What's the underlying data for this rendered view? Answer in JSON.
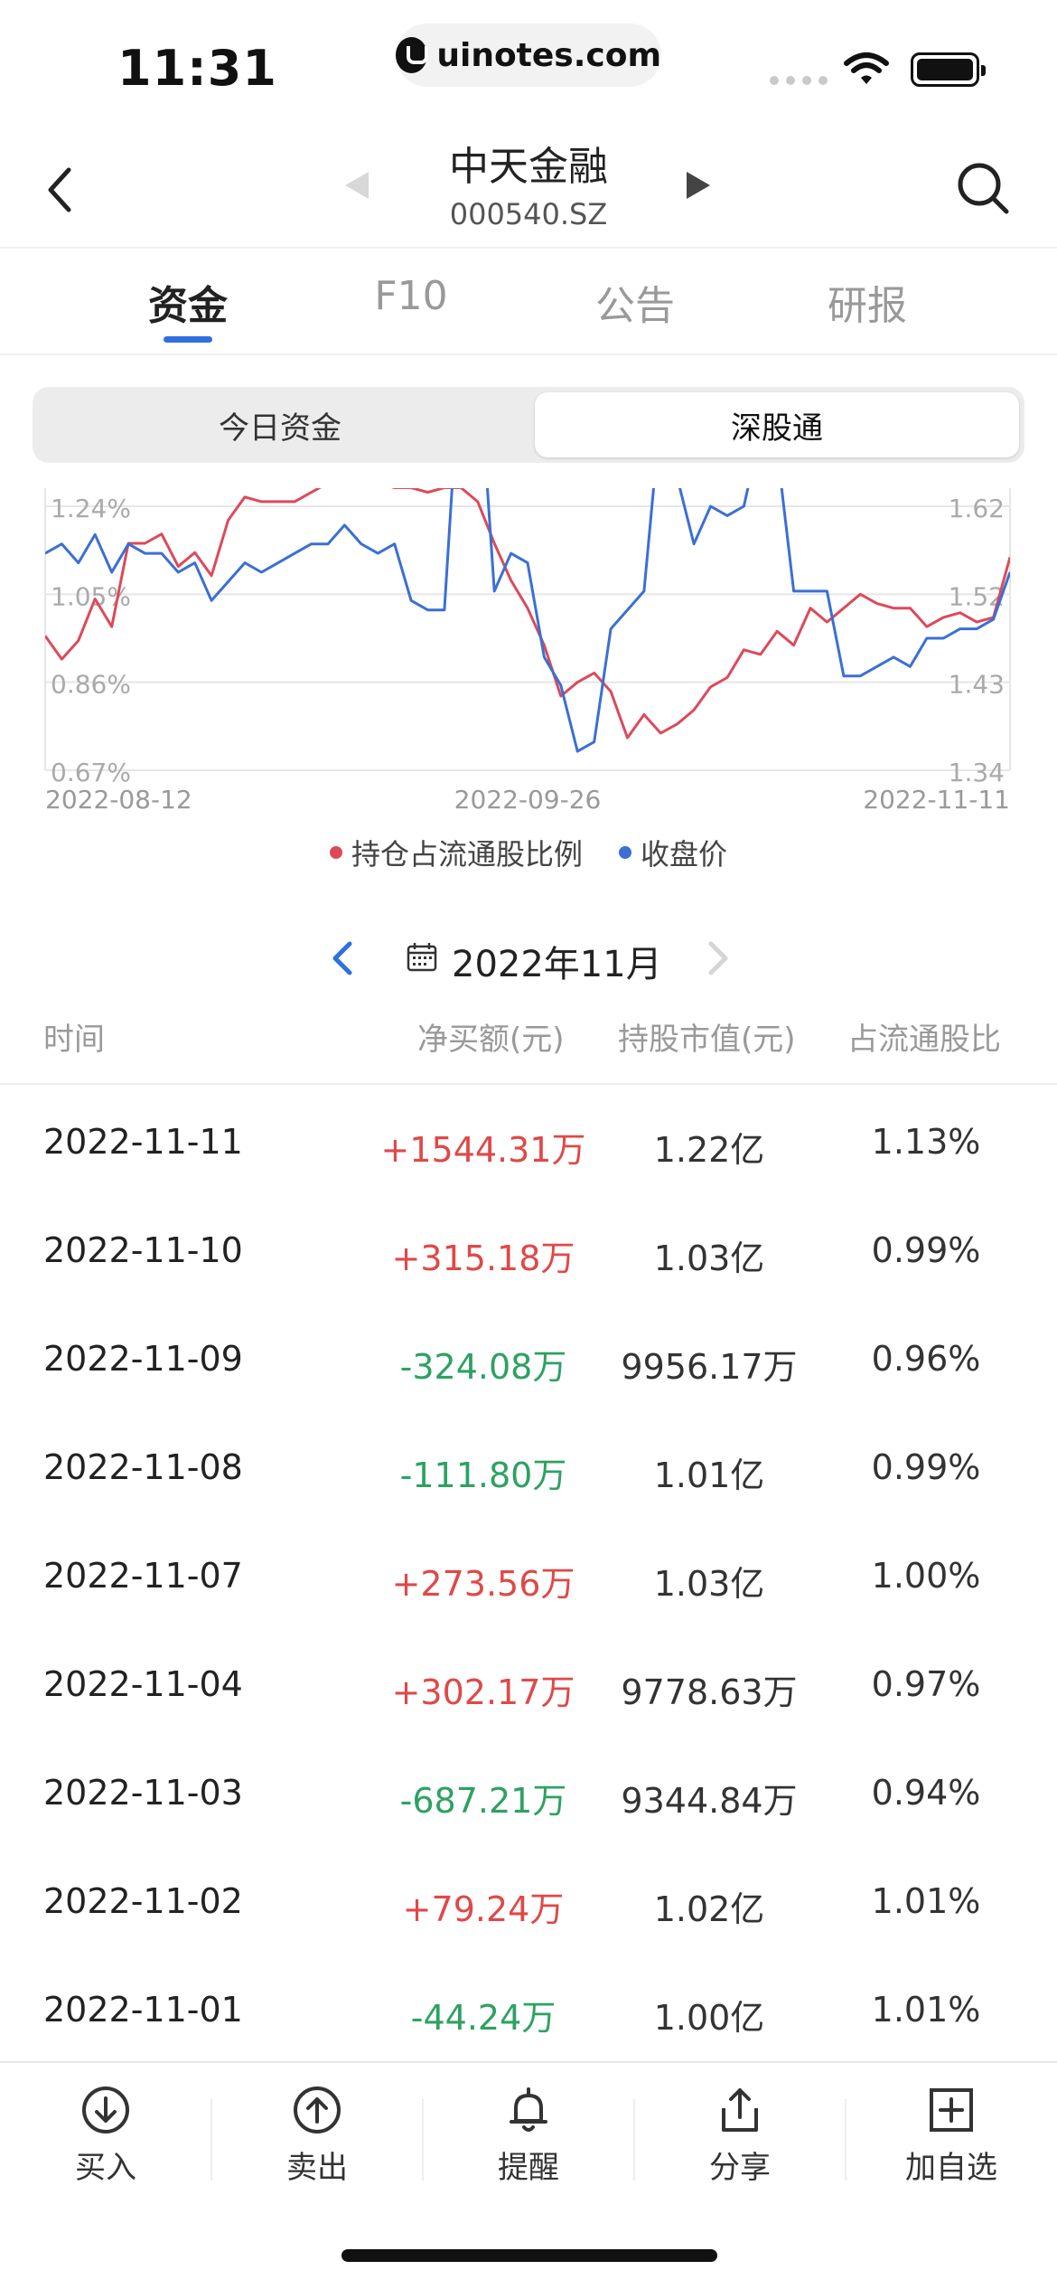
{
  "status": {
    "time": "11:31",
    "url": "uinotes.com"
  },
  "header": {
    "stock_name": "中天金融",
    "stock_code": "000540.SZ"
  },
  "tabs": [
    {
      "label": "资金",
      "active": true
    },
    {
      "label": "F10",
      "active": false
    },
    {
      "label": "公告",
      "active": false
    },
    {
      "label": "研报",
      "active": false
    }
  ],
  "segment": {
    "items": [
      "今日资金",
      "深股通"
    ],
    "selected": "深股通"
  },
  "chart_data": {
    "type": "line",
    "x_start": "2022-08-12",
    "x_mid": "2022-09-26",
    "x_end": "2022-11-11",
    "x_tick_labels": [
      "2022-08-12",
      "2022-09-26",
      "2022-11-11"
    ],
    "left_axis_ticks": [
      "1.24%",
      "1.05%",
      "0.86%",
      "0.67%"
    ],
    "right_axis_ticks": [
      "1.62",
      "1.52",
      "1.43",
      "1.34"
    ],
    "ylim_left": [
      0.67,
      1.24
    ],
    "ylim_right": [
      1.34,
      1.62
    ],
    "series": [
      {
        "name": "持仓占流通股比例",
        "axis": "left",
        "color": "#dc4a5a",
        "values": [
          0.96,
          0.91,
          0.95,
          1.04,
          0.98,
          1.16,
          1.16,
          1.18,
          1.11,
          1.14,
          1.09,
          1.21,
          1.26,
          1.25,
          1.25,
          1.25,
          1.27,
          1.29,
          1.3,
          1.31,
          1.29,
          1.28,
          1.28,
          1.27,
          1.28,
          1.28,
          1.25,
          1.16,
          1.08,
          1.02,
          0.94,
          0.83,
          0.86,
          0.88,
          0.84,
          0.74,
          0.79,
          0.75,
          0.77,
          0.8,
          0.85,
          0.87,
          0.93,
          0.92,
          0.97,
          0.94,
          1.02,
          0.99,
          1.02,
          1.05,
          1.03,
          1.02,
          1.02,
          0.98,
          1.0,
          1.01,
          0.99,
          1.0,
          1.13
        ]
      },
      {
        "name": "收盘价",
        "axis": "right",
        "color": "#3b6fd4",
        "values": [
          1.57,
          1.58,
          1.56,
          1.59,
          1.55,
          1.58,
          1.57,
          1.57,
          1.55,
          1.56,
          1.52,
          1.54,
          1.56,
          1.55,
          1.56,
          1.57,
          1.58,
          1.58,
          1.6,
          1.58,
          1.57,
          1.58,
          1.52,
          1.51,
          1.51,
          1.79,
          1.79,
          1.53,
          1.57,
          1.56,
          1.46,
          1.43,
          1.36,
          1.37,
          1.49,
          1.51,
          1.53,
          1.72,
          1.65,
          1.58,
          1.62,
          1.61,
          1.62,
          1.7,
          1.68,
          1.53,
          1.53,
          1.53,
          1.44,
          1.44,
          1.45,
          1.46,
          1.45,
          1.48,
          1.48,
          1.49,
          1.49,
          1.5,
          1.55
        ]
      }
    ],
    "legend": [
      "持仓占流通股比例",
      "收盘价"
    ],
    "legend_position": "bottom-center",
    "grid": true
  },
  "month": {
    "label": "2022年11月"
  },
  "table": {
    "headers": [
      "时间",
      "净买额(元)",
      "持股市值(元)",
      "占流通股比"
    ],
    "rows": [
      {
        "date": "2022-11-11",
        "net": "+1544.31万",
        "dir": "pos",
        "value": "1.22亿",
        "pct": "1.13%"
      },
      {
        "date": "2022-11-10",
        "net": "+315.18万",
        "dir": "pos",
        "value": "1.03亿",
        "pct": "0.99%"
      },
      {
        "date": "2022-11-09",
        "net": "-324.08万",
        "dir": "neg",
        "value": "9956.17万",
        "pct": "0.96%"
      },
      {
        "date": "2022-11-08",
        "net": "-111.80万",
        "dir": "neg",
        "value": "1.01亿",
        "pct": "0.99%"
      },
      {
        "date": "2022-11-07",
        "net": "+273.56万",
        "dir": "pos",
        "value": "1.03亿",
        "pct": "1.00%"
      },
      {
        "date": "2022-11-04",
        "net": "+302.17万",
        "dir": "pos",
        "value": "9778.63万",
        "pct": "0.97%"
      },
      {
        "date": "2022-11-03",
        "net": "-687.21万",
        "dir": "neg",
        "value": "9344.84万",
        "pct": "0.94%"
      },
      {
        "date": "2022-11-02",
        "net": "+79.24万",
        "dir": "pos",
        "value": "1.02亿",
        "pct": "1.01%"
      },
      {
        "date": "2022-11-01",
        "net": "-44.24万",
        "dir": "neg",
        "value": "1.00亿",
        "pct": "1.01%"
      }
    ]
  },
  "bottom_bar": [
    {
      "label": "买入",
      "icon": "arrow-down-circle-icon"
    },
    {
      "label": "卖出",
      "icon": "arrow-up-circle-icon"
    },
    {
      "label": "提醒",
      "icon": "bell-icon"
    },
    {
      "label": "分享",
      "icon": "share-icon"
    },
    {
      "label": "加自选",
      "icon": "plus-square-icon"
    }
  ],
  "colors": {
    "accent": "#2f6fe0",
    "positive": "#e04848",
    "negative": "#2ea162"
  }
}
